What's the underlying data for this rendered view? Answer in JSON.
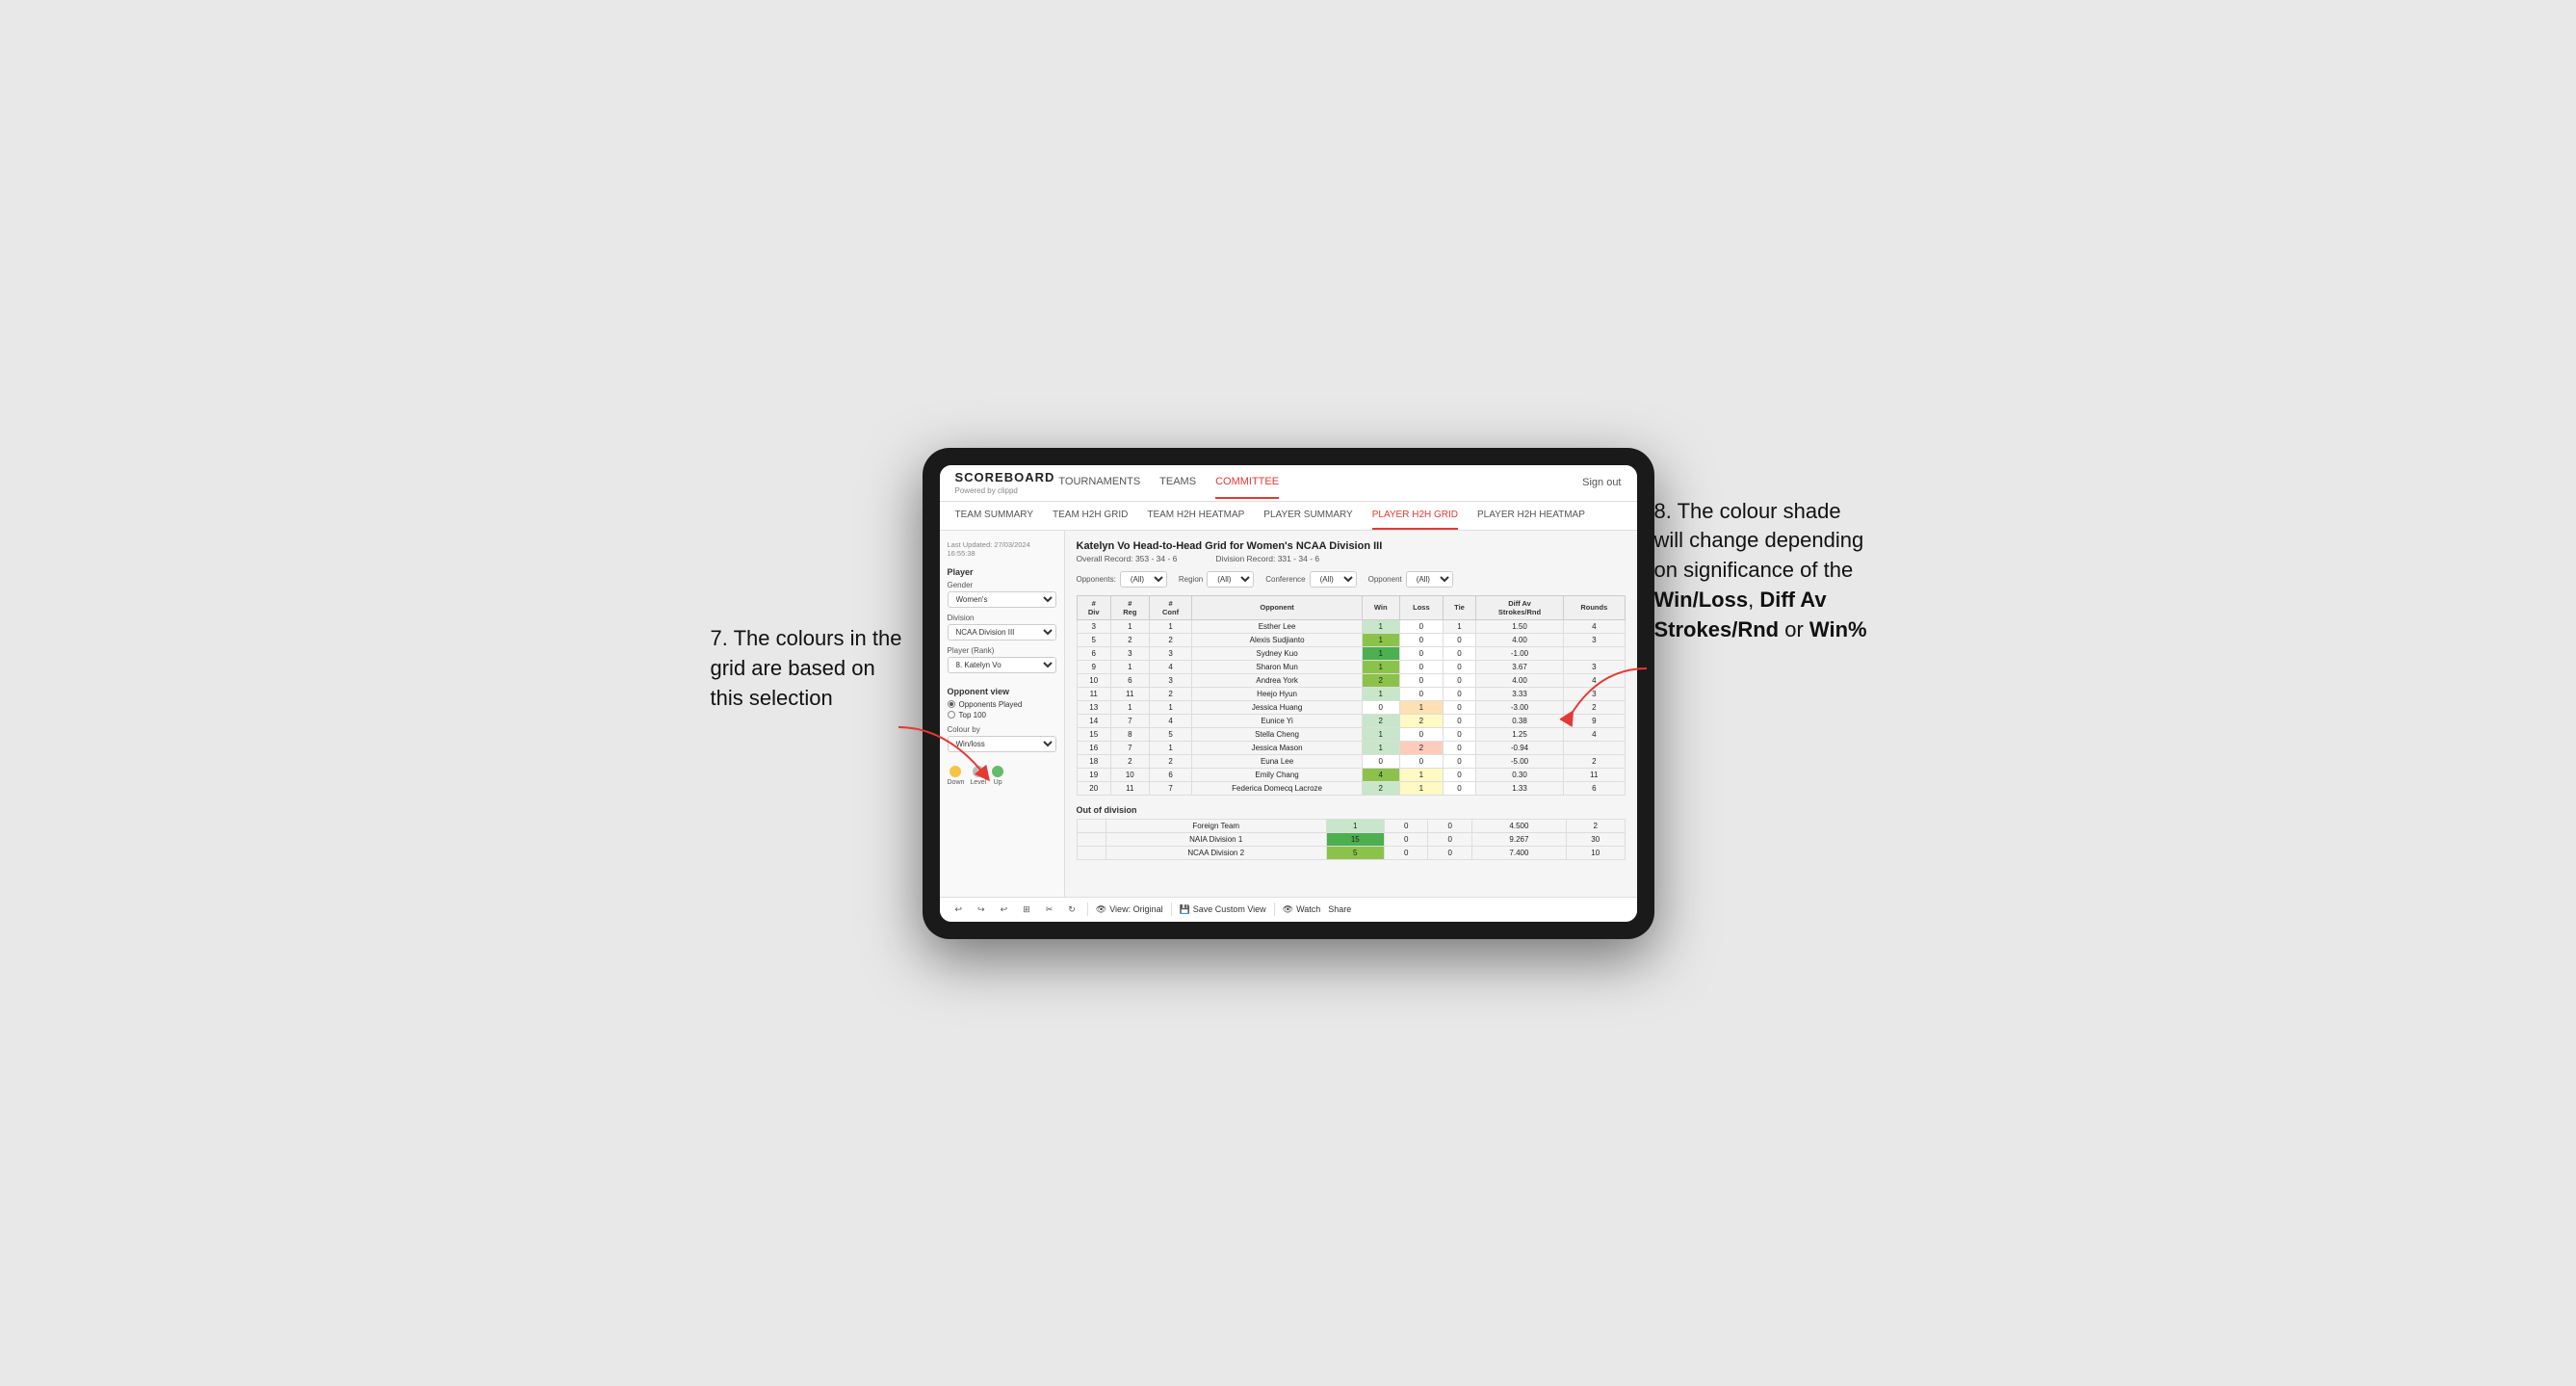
{
  "annotations": {
    "left_title": "7. The colours in the grid are based on this selection",
    "right_title": "8. The colour shade will change depending on significance of the",
    "right_bold1": "Win/Loss",
    "right_bold2": "Diff Av Strokes/Rnd",
    "right_bold3": "Win%"
  },
  "header": {
    "logo": "SCOREBOARD",
    "logo_sub": "Powered by clippd",
    "nav": [
      "TOURNAMENTS",
      "TEAMS",
      "COMMITTEE"
    ],
    "active_nav": "COMMITTEE",
    "sign_in": "Sign out"
  },
  "subnav": [
    "TEAM SUMMARY",
    "TEAM H2H GRID",
    "TEAM H2H HEATMAP",
    "PLAYER SUMMARY",
    "PLAYER H2H GRID",
    "PLAYER H2H HEATMAP"
  ],
  "active_subnav": "PLAYER H2H GRID",
  "sidebar": {
    "timestamp": "Last Updated: 27/03/2024 16:55:38",
    "player_label": "Player",
    "gender_label": "Gender",
    "gender_value": "Women's",
    "division_label": "Division",
    "division_value": "NCAA Division III",
    "player_rank_label": "Player (Rank)",
    "player_rank_value": "8. Katelyn Vo",
    "opponent_view_label": "Opponent view",
    "opponent_options": [
      "Opponents Played",
      "Top 100"
    ],
    "opponent_selected": "Opponents Played",
    "colour_by_label": "Colour by",
    "colour_by_value": "Win/loss",
    "legend": [
      {
        "label": "Down",
        "color": "#f5c542"
      },
      {
        "label": "Level",
        "color": "#bdbdbd"
      },
      {
        "label": "Up",
        "color": "#66bb6a"
      }
    ]
  },
  "grid": {
    "title": "Katelyn Vo Head-to-Head Grid for Women's NCAA Division III",
    "overall_record_label": "Overall Record:",
    "overall_record": "353 - 34 - 6",
    "division_record_label": "Division Record:",
    "division_record": "331 - 34 - 6",
    "filters": {
      "opponents_label": "Opponents:",
      "opponents_value": "(All)",
      "region_label": "Region",
      "region_value": "(All)",
      "conference_label": "Conference",
      "conference_value": "(All)",
      "opponent_label": "Opponent",
      "opponent_value": "(All)"
    },
    "col_headers": [
      "#\nDiv",
      "#\nReg",
      "#\nConf",
      "Opponent",
      "Win",
      "Loss",
      "Tie",
      "Diff Av\nStrokes/Rnd",
      "Rounds"
    ],
    "rows": [
      {
        "div": "3",
        "reg": "1",
        "conf": "1",
        "opponent": "Esther Lee",
        "win": "1",
        "loss": "0",
        "tie": "1",
        "diff": "1.50",
        "rounds": "4",
        "win_color": "cell-green-light",
        "loss_color": "cell-empty",
        "tie_color": "cell-neutral"
      },
      {
        "div": "5",
        "reg": "2",
        "conf": "2",
        "opponent": "Alexis Sudjianto",
        "win": "1",
        "loss": "0",
        "tie": "0",
        "diff": "4.00",
        "rounds": "3",
        "win_color": "cell-green-mid",
        "loss_color": "cell-empty",
        "tie_color": "cell-empty"
      },
      {
        "div": "6",
        "reg": "3",
        "conf": "3",
        "opponent": "Sydney Kuo",
        "win": "1",
        "loss": "0",
        "tie": "0",
        "diff": "-1.00",
        "rounds": "",
        "win_color": "cell-green-dark",
        "loss_color": "cell-empty",
        "tie_color": "cell-empty"
      },
      {
        "div": "9",
        "reg": "1",
        "conf": "4",
        "opponent": "Sharon Mun",
        "win": "1",
        "loss": "0",
        "tie": "0",
        "diff": "3.67",
        "rounds": "3",
        "win_color": "cell-green-mid",
        "loss_color": "cell-empty",
        "tie_color": "cell-empty"
      },
      {
        "div": "10",
        "reg": "6",
        "conf": "3",
        "opponent": "Andrea York",
        "win": "2",
        "loss": "0",
        "tie": "0",
        "diff": "4.00",
        "rounds": "4",
        "win_color": "cell-green-mid",
        "loss_color": "cell-empty",
        "tie_color": "cell-empty"
      },
      {
        "div": "11",
        "reg": "11",
        "conf": "2",
        "opponent": "Heejo Hyun",
        "win": "1",
        "loss": "0",
        "tie": "0",
        "diff": "3.33",
        "rounds": "3",
        "win_color": "cell-green-light",
        "loss_color": "cell-empty",
        "tie_color": "cell-empty"
      },
      {
        "div": "13",
        "reg": "1",
        "conf": "1",
        "opponent": "Jessica Huang",
        "win": "0",
        "loss": "1",
        "tie": "0",
        "diff": "-3.00",
        "rounds": "2",
        "win_color": "cell-empty",
        "loss_color": "cell-orange",
        "tie_color": "cell-empty"
      },
      {
        "div": "14",
        "reg": "7",
        "conf": "4",
        "opponent": "Eunice Yi",
        "win": "2",
        "loss": "2",
        "tie": "0",
        "diff": "0.38",
        "rounds": "9",
        "win_color": "cell-green-light",
        "loss_color": "cell-yellow",
        "tie_color": "cell-empty"
      },
      {
        "div": "15",
        "reg": "8",
        "conf": "5",
        "opponent": "Stella Cheng",
        "win": "1",
        "loss": "0",
        "tie": "0",
        "diff": "1.25",
        "rounds": "4",
        "win_color": "cell-green-light",
        "loss_color": "cell-empty",
        "tie_color": "cell-empty"
      },
      {
        "div": "16",
        "reg": "7",
        "conf": "1",
        "opponent": "Jessica Mason",
        "win": "1",
        "loss": "2",
        "tie": "0",
        "diff": "-0.94",
        "rounds": "",
        "win_color": "cell-green-light",
        "loss_color": "cell-red-light",
        "tie_color": "cell-empty"
      },
      {
        "div": "18",
        "reg": "2",
        "conf": "2",
        "opponent": "Euna Lee",
        "win": "0",
        "loss": "0",
        "tie": "0",
        "diff": "-5.00",
        "rounds": "2",
        "win_color": "cell-empty",
        "loss_color": "cell-empty",
        "tie_color": "cell-empty"
      },
      {
        "div": "19",
        "reg": "10",
        "conf": "6",
        "opponent": "Emily Chang",
        "win": "4",
        "loss": "1",
        "tie": "0",
        "diff": "0.30",
        "rounds": "11",
        "win_color": "cell-green-mid",
        "loss_color": "cell-yellow",
        "tie_color": "cell-empty"
      },
      {
        "div": "20",
        "reg": "11",
        "conf": "7",
        "opponent": "Federica Domecq Lacroze",
        "win": "2",
        "loss": "1",
        "tie": "0",
        "diff": "1.33",
        "rounds": "6",
        "win_color": "cell-green-light",
        "loss_color": "cell-yellow",
        "tie_color": "cell-empty"
      }
    ],
    "out_of_division_label": "Out of division",
    "out_of_division_rows": [
      {
        "opponent": "Foreign Team",
        "win": "1",
        "loss": "0",
        "tie": "0",
        "diff": "4.500",
        "rounds": "2",
        "win_color": "cell-green-light"
      },
      {
        "opponent": "NAIA Division 1",
        "win": "15",
        "loss": "0",
        "tie": "0",
        "diff": "9.267",
        "rounds": "30",
        "win_color": "cell-green-dark"
      },
      {
        "opponent": "NCAA Division 2",
        "win": "5",
        "loss": "0",
        "tie": "0",
        "diff": "7.400",
        "rounds": "10",
        "win_color": "cell-green-mid"
      }
    ]
  },
  "toolbar": {
    "view_label": "View: Original",
    "save_label": "Save Custom View",
    "watch_label": "Watch",
    "share_label": "Share"
  }
}
